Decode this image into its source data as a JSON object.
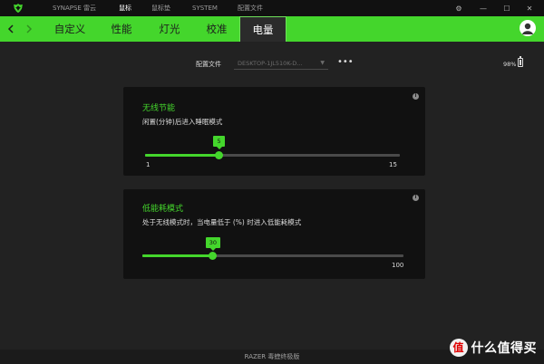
{
  "titlebar": {
    "nav": [
      {
        "label": "SYNAPSE 雷云",
        "active": false
      },
      {
        "label": "鼠标",
        "active": true
      },
      {
        "label": "鼠标垫",
        "active": false
      },
      {
        "label": "SYSTEM",
        "active": false
      },
      {
        "label": "配置文件",
        "active": false
      }
    ],
    "controls": {
      "settings": "⚙",
      "minimize": "—",
      "maximize": "☐",
      "close": "✕"
    }
  },
  "tabs": [
    {
      "label": "自定义",
      "active": false
    },
    {
      "label": "性能",
      "active": false
    },
    {
      "label": "灯光",
      "active": false
    },
    {
      "label": "校准",
      "active": false
    },
    {
      "label": "电量",
      "active": true
    }
  ],
  "profile": {
    "label": "配置文件",
    "value": "DESKTOP-1JL510K-D...",
    "more": "•••"
  },
  "battery": {
    "percent_text": "98%",
    "level": 0.98
  },
  "cards": [
    {
      "title": "无线节能",
      "description": "闲置(分钟)后进入睡眠模式",
      "slider": {
        "value": "5",
        "min": "1",
        "max": "15",
        "fraction": 0.29
      }
    },
    {
      "title": "低能耗模式",
      "description": "处于无线模式时，当电量低于 (%) 时进入低能耗模式",
      "slider": {
        "value": "30",
        "min": "",
        "max": "100",
        "fraction": 0.27
      }
    }
  ],
  "footer": {
    "text": "RAZER 毒蝰终极版"
  },
  "watermark": {
    "badge": "值",
    "text": "什么值得买"
  },
  "colors": {
    "accent": "#44d62c",
    "background": "#222222",
    "card": "#111111"
  }
}
